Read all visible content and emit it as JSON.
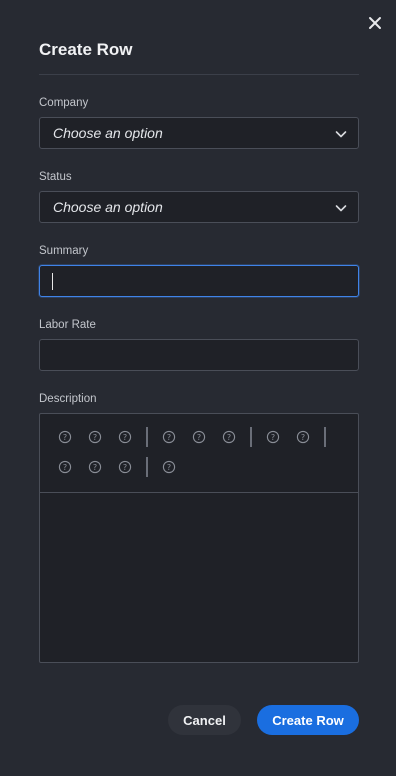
{
  "dialog": {
    "title": "Create Row"
  },
  "fields": {
    "company": {
      "label": "Company",
      "value": "Choose an option"
    },
    "status": {
      "label": "Status",
      "value": "Choose an option"
    },
    "summary": {
      "label": "Summary",
      "value": ""
    },
    "labor_rate": {
      "label": "Labor Rate",
      "value": ""
    },
    "description": {
      "label": "Description",
      "value": ""
    }
  },
  "toolbar": {
    "icons": [
      "unknown-icon",
      "unknown-icon",
      "unknown-icon",
      "unknown-icon",
      "unknown-icon",
      "unknown-icon",
      "unknown-icon",
      "unknown-icon",
      "unknown-icon",
      "unknown-icon",
      "unknown-icon",
      "unknown-icon"
    ],
    "icon_color": "#8a8e97"
  },
  "actions": {
    "cancel_label": "Cancel",
    "create_label": "Create Row"
  },
  "colors": {
    "background": "#272a32",
    "field_bg": "#1f2127",
    "border": "#4a4e58",
    "focus": "#3f83e8",
    "primary": "#1a6ee0"
  }
}
